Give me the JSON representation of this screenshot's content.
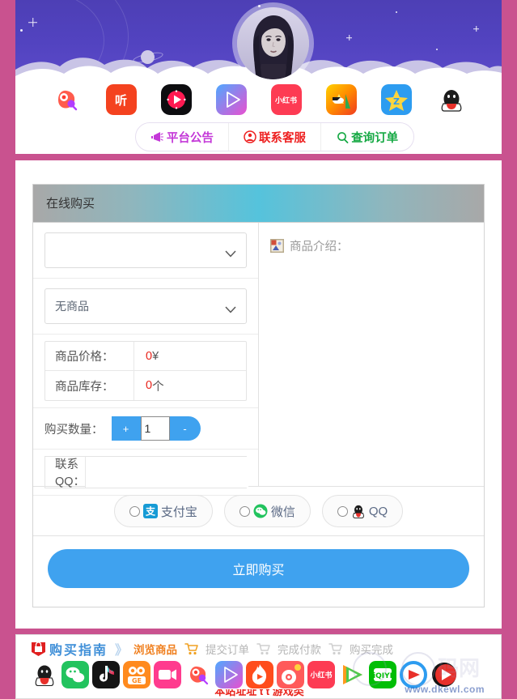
{
  "theme": {
    "page_bg": "#c9528f",
    "card_bg": "#ffffff",
    "sky_top": "#4d3fb5",
    "sky_bottom": "#5b4ac8",
    "accent_blue": "#3fa2ef",
    "price_red": "#e8241b",
    "title_gradient_mid": "#55c3dc",
    "title_gradient_edge": "#a8a8a8",
    "step_blue": "#3f8fd8",
    "step_orange": "#f08020",
    "step_gray": "#b5b5b5"
  },
  "header": {
    "avatar_alt": "user-avatar-portrait",
    "app_icons": [
      {
        "name": "kuaishou-icon",
        "label": ""
      },
      {
        "name": "ting-icon",
        "label": "听"
      },
      {
        "name": "weishi-icon",
        "label": ""
      },
      {
        "name": "bilibili-icon",
        "label": ""
      },
      {
        "name": "xiaohongshu-icon",
        "label": "小红书"
      },
      {
        "name": "momo-icon",
        "label": ""
      },
      {
        "name": "qzone-icon",
        "label": ""
      },
      {
        "name": "qq-icon",
        "label": ""
      }
    ],
    "nav": [
      {
        "name": "platform-announcement",
        "label": "平台公告",
        "color": "#c438d8",
        "icon": "megaphone-icon"
      },
      {
        "name": "contact-support",
        "label": "联系客服",
        "color": "#ee2020",
        "icon": "headset-icon"
      },
      {
        "name": "query-order",
        "label": "查询订单",
        "color": "#16a944",
        "icon": "search-icon"
      }
    ]
  },
  "panel": {
    "title": "在线购买",
    "category_select": {
      "value": "",
      "placeholder": ""
    },
    "product_select": {
      "value": "无商品"
    },
    "fields": [
      {
        "key": "商品价格：",
        "num": "0",
        "unit": "¥"
      },
      {
        "key": "商品库存：",
        "num": "0",
        "unit": "个"
      }
    ],
    "quantity": {
      "label": "购买数量：",
      "plus": "+",
      "minus": "-",
      "value": "1"
    },
    "qq": {
      "label": "联系QQ：",
      "value": "",
      "placeholder": ""
    },
    "intro": {
      "label": "商品介绍：",
      "body": ""
    },
    "payments": [
      {
        "name": "alipay",
        "label": "支付宝",
        "checked": false
      },
      {
        "name": "wechat",
        "label": "微信",
        "checked": false
      },
      {
        "name": "qqpay",
        "label": "QQ",
        "checked": false
      }
    ],
    "buy_button": "立即购买"
  },
  "footer": {
    "guide_label": "购买指南",
    "chevron": "》",
    "steps": [
      {
        "label": "浏览商品",
        "state": "active"
      },
      {
        "label": "提交订单",
        "state": "idle"
      },
      {
        "label": "完成付款",
        "state": "idle"
      },
      {
        "label": "购买完成",
        "state": "idle"
      }
    ],
    "brands": [
      "qq-icon",
      "wechat-icon",
      "douyin-icon",
      "kuaishou-icon",
      "weishi-icon",
      "kuaishou-alt-icon",
      "bilibili-icon",
      "huoshan-icon",
      "weibo-icon",
      "xiaohongshu-icon",
      "tencent-video-icon",
      "iqiyi-icon",
      "xigua-icon",
      "youku-icon"
    ],
    "watermark": "www.dkewl.com"
  }
}
